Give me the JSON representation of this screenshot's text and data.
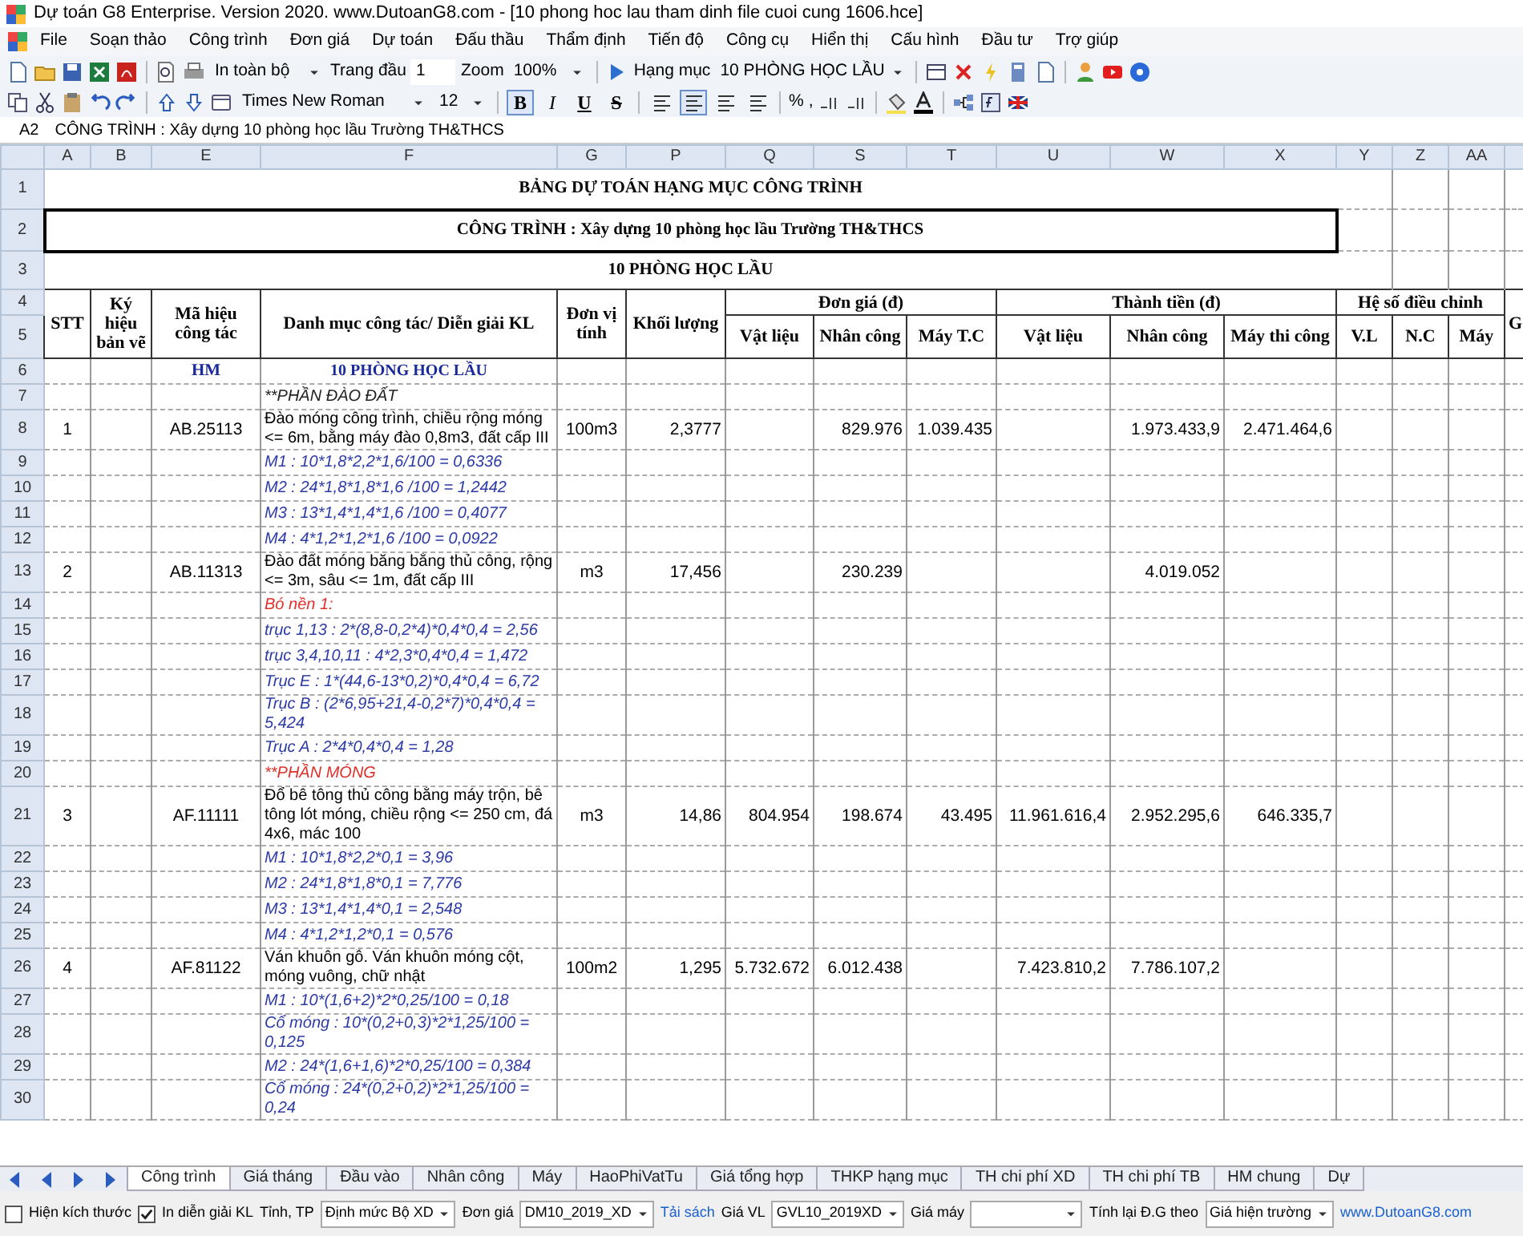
{
  "window": {
    "title": "Dự toán G8 Enterprise. Version 2020.   www.DutoanG8.com  - [10 phong hoc lau tham dinh file cuoi cung 1606.hce]"
  },
  "menu": [
    "File",
    "Soạn thảo",
    "Công trình",
    "Đơn giá",
    "Dự toán",
    "Đấu thầu",
    "Thẩm định",
    "Tiến độ",
    "Công cụ",
    "Hiển thị",
    "Cấu hình",
    "Đầu tư",
    "Trợ giúp"
  ],
  "toolbar": {
    "print_range": "In toàn bộ",
    "page_label": "Trang đầu",
    "page_value": "1",
    "zoom_label": "Zoom",
    "zoom_value": "100%",
    "category_label": "Hạng mục",
    "category_value": "10 PHÒNG HỌC LẦU"
  },
  "format_bar": {
    "font": "Times New Roman",
    "size": "12",
    "style_buttons": [
      {
        "label": "B",
        "selected": true
      },
      {
        "label": "I",
        "selected": false
      },
      {
        "label": "U",
        "selected": false
      },
      {
        "label": "S",
        "selected": false
      }
    ],
    "align_buttons": [
      {
        "selected": false
      },
      {
        "selected": true
      },
      {
        "selected": false
      },
      {
        "selected": false
      }
    ],
    "percent": "%",
    "comma": ","
  },
  "formula_bar": {
    "cell": "A2",
    "content": "CÔNG TRÌNH : Xây dựng 10 phòng học lầu Trường TH&THCS"
  },
  "columns": [
    "A",
    "B",
    "E",
    "F",
    "G",
    "P",
    "Q",
    "S",
    "T",
    "U",
    "W",
    "X",
    "Y",
    "Z",
    "AA"
  ],
  "sheet": {
    "top_rows": [
      "1",
      "2",
      "3",
      "4",
      "5"
    ],
    "title": "BẢNG DỰ TOÁN HẠNG MỤC CÔNG TRÌNH",
    "project": "CÔNG TRÌNH : Xây dựng 10 phòng học lầu Trường TH&THCS",
    "section": "10 PHÒNG HỌC LẦU",
    "header": {
      "stt": "STT",
      "drawing_code": "Ký hiệu bản vẽ",
      "work_code": "Mã hiệu công tác",
      "description": "Danh mục công tác/ Diễn giải KL",
      "unit": "Đơn vị tính",
      "quantity": "Khối lượng",
      "unit_price": "Đơn giá (đ)",
      "total": "Thành tiền (đ)",
      "coefficient": "Hệ số điều chỉnh",
      "material": "Vật liệu",
      "labor": "Nhân công",
      "machine": "Máy T.C",
      "total_material": "Vật liệu",
      "total_labor": "Nhân công",
      "total_machine": "Máy thi công",
      "coef_material": "V.L",
      "coef_labor": "N.C",
      "coef_machine": "Máy",
      "overflow": "G"
    },
    "rows": [
      {
        "row": "6",
        "kind": "group",
        "work_code": "HM",
        "description": "10 PHÒNG HỌC LẦU"
      },
      {
        "row": "7",
        "kind": "note",
        "description": "**PHẦN ĐÀO ĐẤT"
      },
      {
        "row": "8",
        "kind": "item",
        "stt": "1",
        "work_code": "AB.25113",
        "description": "Đào móng công trình, chiều rộng móng <= 6m, bằng máy đào 0,8m3, đất cấp III",
        "unit": "100m3",
        "quantity": "2,3777",
        "unit_price_labor": "829.976",
        "unit_price_machine": "1.039.435",
        "total_labor": "1.973.433,9",
        "total_machine": "2.471.464,6"
      },
      {
        "row": "9",
        "kind": "formula",
        "description": "M1 : 10*1,8*2,2*1,6/100 = 0,6336"
      },
      {
        "row": "10",
        "kind": "formula",
        "description": "M2 : 24*1,8*1,8*1,6 /100 = 1,2442"
      },
      {
        "row": "11",
        "kind": "formula",
        "description": "M3 : 13*1,4*1,4*1,6 /100 = 0,4077"
      },
      {
        "row": "12",
        "kind": "formula",
        "description": "M4 : 4*1,2*1,2*1,6 /100 = 0,0922"
      },
      {
        "row": "13",
        "kind": "item",
        "stt": "2",
        "work_code": "AB.11313",
        "description": "Đào đất móng băng bằng thủ công, rộng <= 3m, sâu <= 1m, đất cấp III",
        "unit": "m3",
        "quantity": "17,456",
        "unit_price_labor": "230.239",
        "total_labor": "4.019.052"
      },
      {
        "row": "14",
        "kind": "label",
        "description": "Bó nền 1:"
      },
      {
        "row": "15",
        "kind": "formula",
        "description": "trục 1,13 : 2*(8,8-0,2*4)*0,4*0,4 = 2,56"
      },
      {
        "row": "16",
        "kind": "formula",
        "description": "trục 3,4,10,11 : 4*2,3*0,4*0,4 = 1,472"
      },
      {
        "row": "17",
        "kind": "formula",
        "description": "Trục E : 1*(44,6-13*0,2)*0,4*0,4 = 6,72"
      },
      {
        "row": "18",
        "kind": "formula",
        "description": "Trục B : (2*6,95+21,4-0,2*7)*0,4*0,4 = 5,424"
      },
      {
        "row": "19",
        "kind": "formula",
        "description": "Trục A : 2*4*0,4*0,4 = 1,28"
      },
      {
        "row": "20",
        "kind": "label",
        "description": "**PHẦN MÓNG"
      },
      {
        "row": "21",
        "kind": "item",
        "stt": "3",
        "work_code": "AF.11111",
        "description": "Đổ bê tông thủ công bằng máy trộn, bê tông lót móng, chiều rộng <= 250 cm, đá 4x6, mác 100",
        "unit": "m3",
        "quantity": "14,86",
        "unit_price_material": "804.954",
        "unit_price_labor": "198.674",
        "unit_price_machine": "43.495",
        "total_material": "11.961.616,4",
        "total_labor": "2.952.295,6",
        "total_machine": "646.335,7"
      },
      {
        "row": "22",
        "kind": "formula",
        "description": "M1 : 10*1,8*2,2*0,1 = 3,96"
      },
      {
        "row": "23",
        "kind": "formula",
        "description": "M2 : 24*1,8*1,8*0,1 = 7,776"
      },
      {
        "row": "24",
        "kind": "formula",
        "description": "M3 : 13*1,4*1,4*0,1 = 2,548"
      },
      {
        "row": "25",
        "kind": "formula",
        "description": "M4 : 4*1,2*1,2*0,1 = 0,576"
      },
      {
        "row": "26",
        "kind": "item",
        "stt": "4",
        "work_code": "AF.81122",
        "description": "Ván khuôn gỗ. Ván khuôn móng cột, móng vuông, chữ nhật",
        "unit": "100m2",
        "quantity": "1,295",
        "unit_price_material": "5.732.672",
        "unit_price_labor": "6.012.438",
        "total_material": "7.423.810,2",
        "total_labor": "7.786.107,2"
      },
      {
        "row": "27",
        "kind": "formula",
        "description": "M1 : 10*(1,6+2)*2*0,25/100 = 0,18"
      },
      {
        "row": "28",
        "kind": "formula",
        "description": "Cổ móng : 10*(0,2+0,3)*2*1,25/100 = 0,125"
      },
      {
        "row": "29",
        "kind": "formula",
        "description": "M2 : 24*(1,6+1,6)*2*0,25/100 = 0,384"
      },
      {
        "row": "30",
        "kind": "formula",
        "description": "Cổ móng : 24*(0,2+0,2)*2*1,25/100 = 0,24"
      }
    ]
  },
  "sheet_tabs": [
    {
      "label": "Công trình",
      "selected": true
    },
    {
      "label": "Giá tháng",
      "selected": false
    },
    {
      "label": "Đầu vào",
      "selected": false
    },
    {
      "label": "Nhân công",
      "selected": false
    },
    {
      "label": "Máy",
      "selected": false
    },
    {
      "label": "HaoPhiVatTu",
      "selected": false
    },
    {
      "label": "Giá tổng hợp",
      "selected": false
    },
    {
      "label": "THKP hạng mục",
      "selected": false
    },
    {
      "label": "TH chi phí XD",
      "selected": false
    },
    {
      "label": "TH chi phí TB",
      "selected": false
    },
    {
      "label": "HM chung",
      "selected": false
    },
    {
      "label": "Dự",
      "selected": false
    }
  ],
  "status_bar": [
    {
      "kind": "checkbox",
      "label": "Hiện kích thước",
      "checked": false
    },
    {
      "kind": "checkbox",
      "label": "In diễn giải KL",
      "checked": true
    },
    {
      "kind": "select",
      "label": "Tỉnh, TP",
      "value": "Định mức Bộ XD"
    },
    {
      "kind": "select",
      "label": "Đơn giá",
      "value": "DM10_2019_XD"
    },
    {
      "kind": "link",
      "label": "Tải sách"
    },
    {
      "kind": "select",
      "label": "Giá VL",
      "value": "GVL10_2019XD"
    },
    {
      "kind": "select",
      "label": "Giá máy"
    },
    {
      "kind": "select",
      "label": "Tính lại Đ.G theo",
      "value": "Giá hiện trường"
    },
    {
      "kind": "link",
      "label": "www.DutoanG8.com"
    }
  ]
}
